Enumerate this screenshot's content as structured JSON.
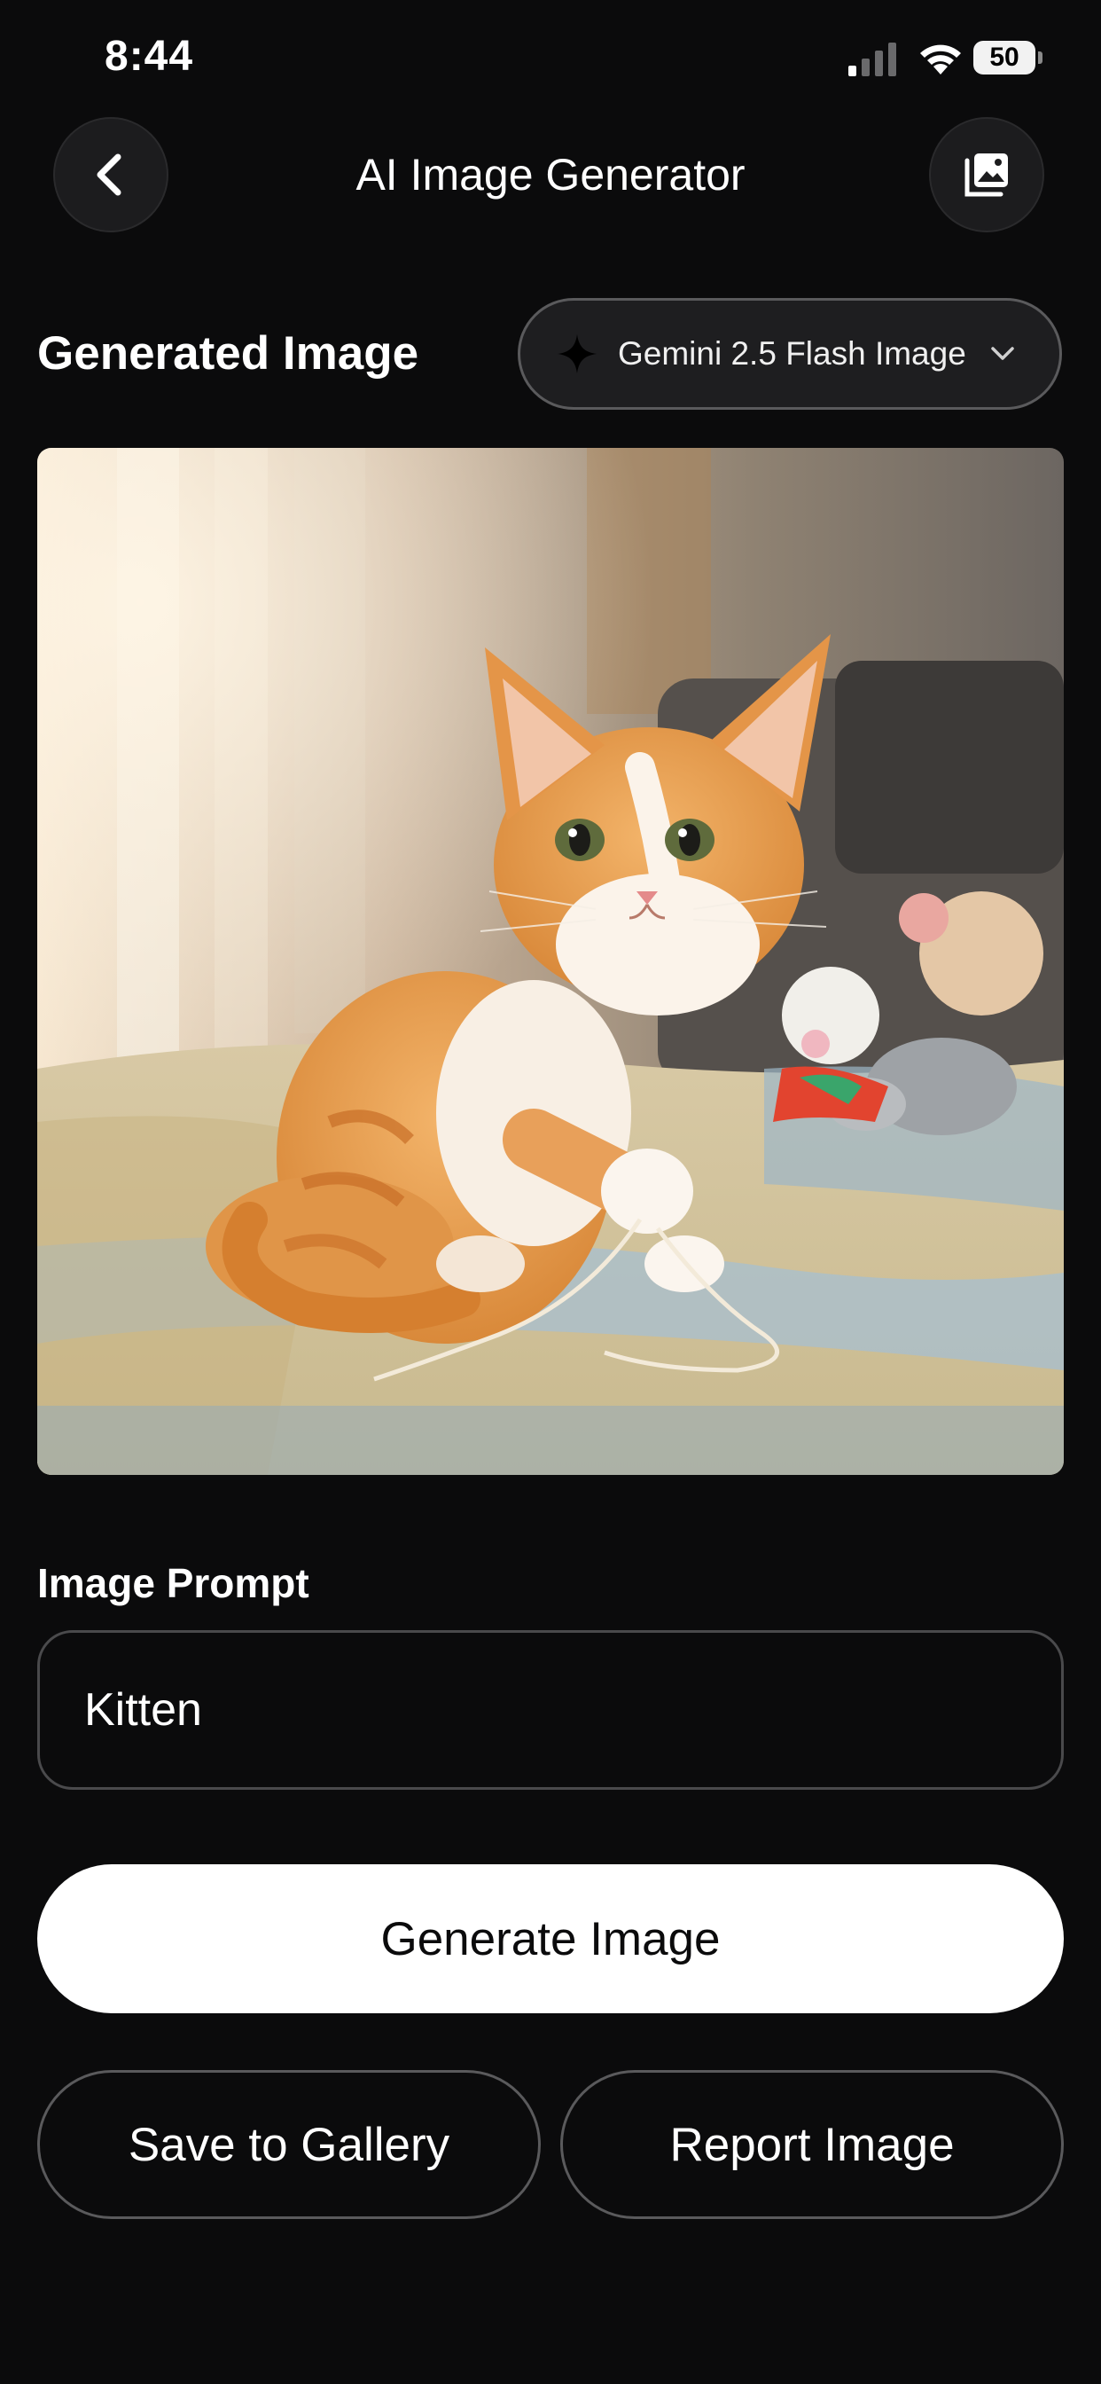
{
  "status_bar": {
    "time": "8:44",
    "battery": "50"
  },
  "header": {
    "title": "AI Image Generator",
    "back_icon": "chevron-left-icon",
    "gallery_icon": "photo-gallery-icon"
  },
  "generated": {
    "section_title": "Generated Image",
    "model_selector": {
      "label": "Gemini 2.5 Flash Image",
      "icon": "sparkle-icon"
    }
  },
  "prompt": {
    "label": "Image Prompt",
    "value": "Kitten"
  },
  "actions": {
    "generate": "Generate Image",
    "save": "Save to Gallery",
    "report": "Report Image"
  },
  "colors": {
    "background": "#0b0b0c",
    "surface": "#1c1c1e",
    "primary_button": "#ffffff",
    "border": "#5a5a5c"
  }
}
